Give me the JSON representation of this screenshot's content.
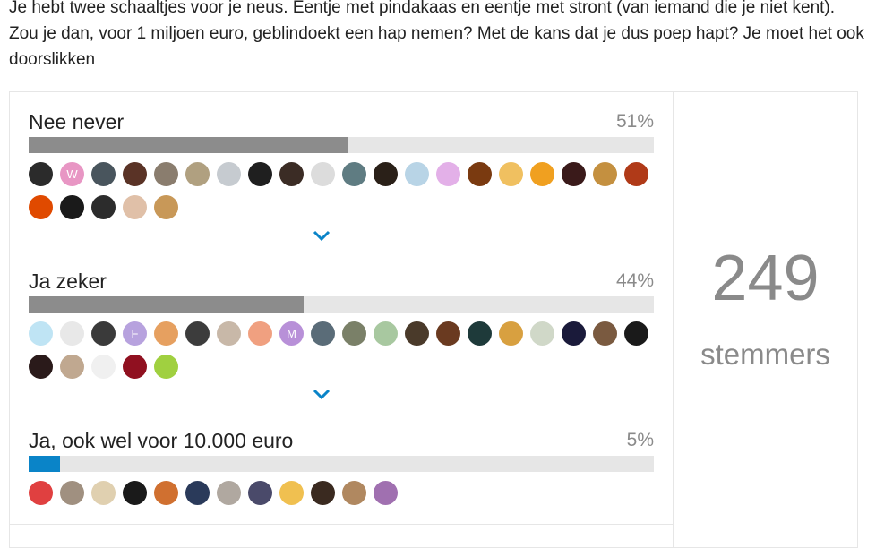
{
  "question": "Je hebt twee schaaltjes voor je neus. Eentje met pindakaas en eentje met stront (van iemand die je niet kent). Zou je dan, voor 1 miljoen euro, geblindoekt een hap nemen? Met de kans dat je dus poep hapt? Je moet het ook doorslikken",
  "options": [
    {
      "label": "Nee never",
      "percent_text": "51%",
      "percent": 51,
      "bar_color": "#8c8c8c",
      "has_expand": true,
      "avatars": [
        "#2b2b2b",
        "#e896c4",
        "#49555d",
        "#5a3326",
        "#8a7d6e",
        "#b0a080",
        "#c6cbd0",
        "#1f1f1f",
        "#3b2c25",
        "#dcdcdc",
        "#5f7c82",
        "#2a2018",
        "#b8d4e6",
        "#e3b0e8",
        "#7a3a10",
        "#f0c060",
        "#f0a020",
        "#3a1a1a",
        "#c49040",
        "#b03a18",
        "#e04a00",
        "#1a1a1a",
        "#2c2c2c",
        "#e0c0a8",
        "#c89858"
      ],
      "avatar_letters": [
        "",
        "W",
        "",
        "",
        "",
        "",
        "",
        "",
        "",
        "",
        "",
        "",
        "",
        "",
        "",
        "",
        "",
        "",
        "",
        "",
        "",
        "",
        "",
        "",
        ""
      ]
    },
    {
      "label": "Ja zeker",
      "percent_text": "44%",
      "percent": 44,
      "bar_color": "#8c8c8c",
      "has_expand": true,
      "avatars": [
        "#bfe4f4",
        "#e8e8e8",
        "#3a3a3a",
        "#b7a2de",
        "#e6a060",
        "#3c3c3c",
        "#c8b8a8",
        "#f0a080",
        "#b890d8",
        "#5a6c78",
        "#7a8068",
        "#a8c8a0",
        "#4a3a2a",
        "#6a3a20",
        "#1e3a3a",
        "#d8a040",
        "#d0d8c8",
        "#1a1a3a",
        "#7a5a40",
        "#1a1a1a",
        "#2a1a1a",
        "#c0a890",
        "#f0f0f0",
        "#901020",
        "#a0d040"
      ],
      "avatar_letters": [
        "",
        "",
        "",
        "F",
        "",
        "",
        "",
        "",
        "M",
        "",
        "",
        "",
        "",
        "",
        "",
        "",
        "",
        "",
        "",
        "",
        "",
        "",
        "",
        "",
        ""
      ]
    },
    {
      "label": "Ja, ook wel voor 10.000 euro",
      "percent_text": "5%",
      "percent": 5,
      "bar_color": "#0a84c8",
      "has_expand": false,
      "avatars": [
        "#e04040",
        "#a09080",
        "#e0d0b0",
        "#1a1a1a",
        "#d07030",
        "#2a3a5a",
        "#b0a8a0",
        "#4a4a6a",
        "#f0c050",
        "#3a2a20",
        "#b08860",
        "#a070b0"
      ],
      "avatar_letters": [
        "",
        "",
        "",
        "",
        "",
        "",
        "",
        "",
        "",
        "",
        "",
        ""
      ]
    }
  ],
  "voter_count": "249",
  "voter_label": "stemmers"
}
